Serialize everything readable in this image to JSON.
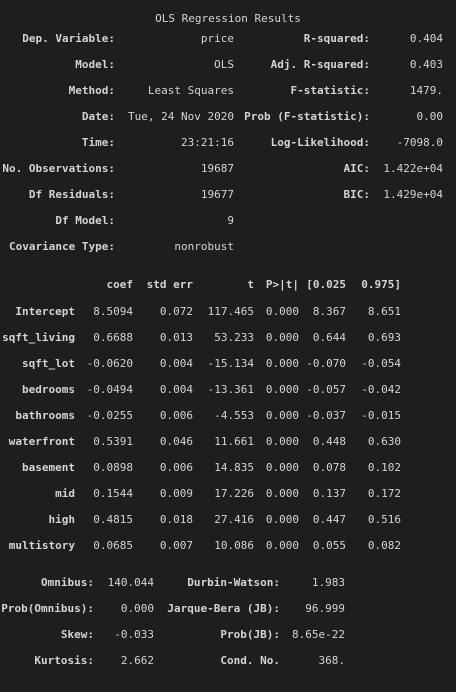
{
  "title": "OLS Regression Results",
  "top": {
    "left": [
      {
        "label": "Dep. Variable:",
        "value": "price"
      },
      {
        "label": "Model:",
        "value": "OLS"
      },
      {
        "label": "Method:",
        "value": "Least Squares"
      },
      {
        "label": "Date:",
        "value": "Tue, 24 Nov 2020"
      },
      {
        "label": "Time:",
        "value": "23:21:16"
      },
      {
        "label": "No. Observations:",
        "value": "19687"
      },
      {
        "label": "Df Residuals:",
        "value": "19677"
      },
      {
        "label": "Df Model:",
        "value": "9"
      },
      {
        "label": "Covariance Type:",
        "value": "nonrobust"
      }
    ],
    "right": [
      {
        "label": "R-squared:",
        "value": "0.404"
      },
      {
        "label": "Adj. R-squared:",
        "value": "0.403"
      },
      {
        "label": "F-statistic:",
        "value": "1479."
      },
      {
        "label": "Prob (F-statistic):",
        "value": "0.00"
      },
      {
        "label": "Log-Likelihood:",
        "value": "-7098.0"
      },
      {
        "label": "AIC:",
        "value": "1.422e+04"
      },
      {
        "label": "BIC:",
        "value": "1.429e+04"
      }
    ]
  },
  "coef_table": {
    "headers": [
      "coef",
      "std err",
      "t",
      "P>|t|",
      "[0.025",
      "0.975]"
    ],
    "rows": [
      {
        "name": "Intercept",
        "vals": [
          "8.5094",
          "0.072",
          "117.465",
          "0.000",
          "8.367",
          "8.651"
        ]
      },
      {
        "name": "sqft_living",
        "vals": [
          "0.6688",
          "0.013",
          "53.233",
          "0.000",
          "0.644",
          "0.693"
        ]
      },
      {
        "name": "sqft_lot",
        "vals": [
          "-0.0620",
          "0.004",
          "-15.134",
          "0.000",
          "-0.070",
          "-0.054"
        ]
      },
      {
        "name": "bedrooms",
        "vals": [
          "-0.0494",
          "0.004",
          "-13.361",
          "0.000",
          "-0.057",
          "-0.042"
        ]
      },
      {
        "name": "bathrooms",
        "vals": [
          "-0.0255",
          "0.006",
          "-4.553",
          "0.000",
          "-0.037",
          "-0.015"
        ]
      },
      {
        "name": "waterfront",
        "vals": [
          "0.5391",
          "0.046",
          "11.661",
          "0.000",
          "0.448",
          "0.630"
        ]
      },
      {
        "name": "basement",
        "vals": [
          "0.0898",
          "0.006",
          "14.835",
          "0.000",
          "0.078",
          "0.102"
        ]
      },
      {
        "name": "mid",
        "vals": [
          "0.1544",
          "0.009",
          "17.226",
          "0.000",
          "0.137",
          "0.172"
        ]
      },
      {
        "name": "high",
        "vals": [
          "0.4815",
          "0.018",
          "27.416",
          "0.000",
          "0.447",
          "0.516"
        ]
      },
      {
        "name": "multistory",
        "vals": [
          "0.0685",
          "0.007",
          "10.086",
          "0.000",
          "0.055",
          "0.082"
        ]
      }
    ]
  },
  "bottom": {
    "left": [
      {
        "label": "Omnibus:",
        "value": "140.044"
      },
      {
        "label": "Prob(Omnibus):",
        "value": "0.000"
      },
      {
        "label": "Skew:",
        "value": "-0.033"
      },
      {
        "label": "Kurtosis:",
        "value": "2.662"
      }
    ],
    "right": [
      {
        "label": "Durbin-Watson:",
        "value": "1.983"
      },
      {
        "label": "Jarque-Bera (JB):",
        "value": "96.999"
      },
      {
        "label": "Prob(JB):",
        "value": "8.65e-22"
      },
      {
        "label": "Cond. No.",
        "value": "368."
      }
    ]
  }
}
